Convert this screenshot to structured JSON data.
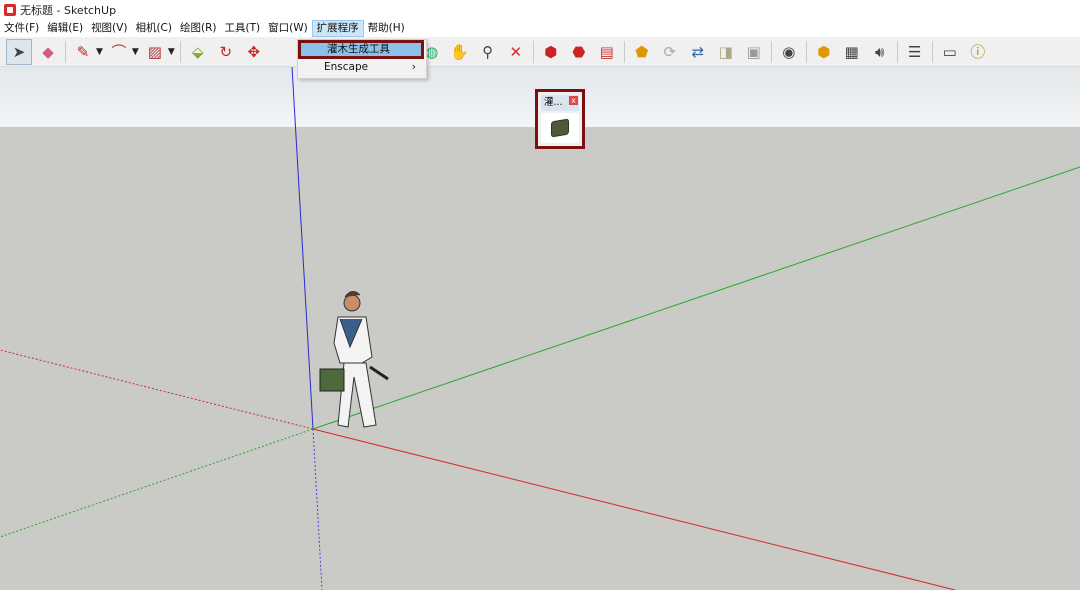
{
  "window": {
    "title": "无标题 - SketchUp"
  },
  "menubar": {
    "items": [
      "文件(F)",
      "编辑(E)",
      "视图(V)",
      "相机(C)",
      "绘图(R)",
      "工具(T)",
      "窗口(W)",
      "扩展程序",
      "帮助(H)"
    ],
    "active_index": 7
  },
  "dropdown": {
    "items": [
      {
        "label": "灌木生成工具",
        "highlighted": true
      },
      {
        "label": "Enscape",
        "submenu_arrow": "›"
      }
    ]
  },
  "panel": {
    "title": "灌...",
    "close_label": "x",
    "tool_icon": "shrub-icon"
  },
  "toolbar": {
    "icons": [
      "select-arrow-icon",
      "eraser-icon",
      "pencil-icon",
      "arc-icon",
      "shape-icon",
      "pushpull-icon",
      "rotate-icon",
      "move-icon",
      "orbit-icon",
      "pan-icon",
      "zoom-icon",
      "zoom-extents-icon",
      "warehouse-icon",
      "extension-icon",
      "layout-icon",
      "shield-icon",
      "refresh-icon",
      "export-icon",
      "camera-icon",
      "photo-icon",
      "goggles-icon",
      "add-location-icon",
      "texture-icon",
      "sound-icon",
      "settings-icon",
      "chat-icon",
      "info-icon"
    ]
  },
  "colors": {
    "axis_red": "#d42a2a",
    "axis_green": "#2aa82a",
    "axis_blue": "#2a2ad4",
    "highlight_border": "#7a1010",
    "ground": "#cacac6"
  }
}
